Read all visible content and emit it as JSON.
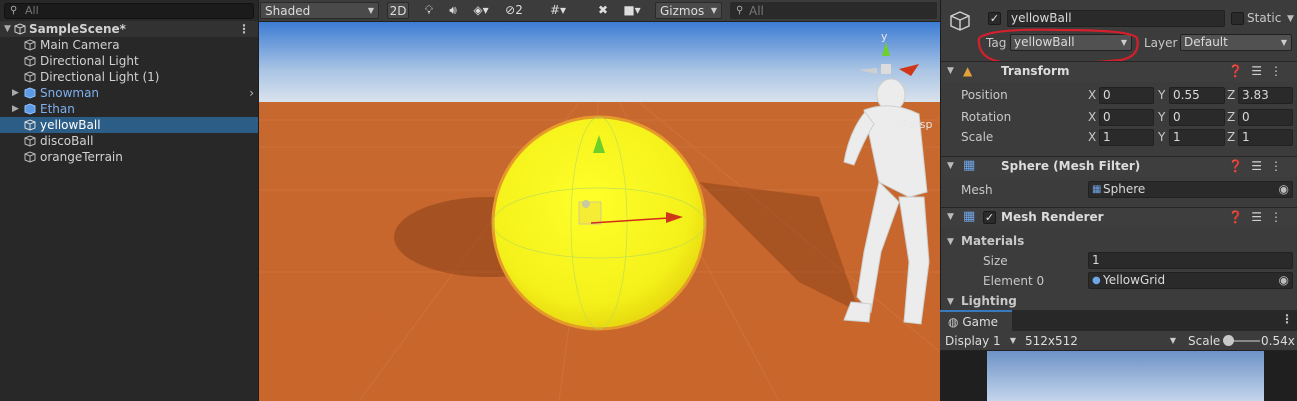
{
  "hierarchy": {
    "search_placeholder": "All",
    "scene_name": "SampleScene*",
    "items": [
      {
        "label": "Main Camera"
      },
      {
        "label": "Directional Light"
      },
      {
        "label": "Directional Light (1)"
      },
      {
        "label": "Snowman"
      },
      {
        "label": "Ethan"
      },
      {
        "label": "yellowBall"
      },
      {
        "label": "discoBall"
      },
      {
        "label": "orangeTerrain"
      }
    ],
    "selected": "yellowBall",
    "prefab_color": "#7fb0ef",
    "selection_color": "#2c5d87"
  },
  "scene_toolbar": {
    "shading_mode": "Shaded",
    "mode_2d": "2D",
    "hidden_count": "2",
    "gizmos_label": "Gizmos",
    "search_placeholder": "All",
    "gizmo_axis_y": "y",
    "persp_label": "<Persp"
  },
  "inspector": {
    "object_name": "yellowBall",
    "static_label": "Static",
    "tag_label": "Tag",
    "tag_value": "yellowBall",
    "layer_label": "Layer",
    "layer_value": "Default",
    "transform": {
      "title": "Transform",
      "position_label": "Position",
      "rotation_label": "Rotation",
      "scale_label": "Scale",
      "position": {
        "x": "0",
        "y": "0.55",
        "z": "3.83"
      },
      "rotation": {
        "x": "0",
        "y": "0",
        "z": "0"
      },
      "scale": {
        "x": "1",
        "y": "1",
        "z": "1"
      }
    },
    "axis_labels": {
      "x": "X",
      "y": "Y",
      "z": "Z"
    },
    "mesh_filter": {
      "title": "Sphere (Mesh Filter)",
      "mesh_label": "Mesh",
      "mesh_value": "Sphere"
    },
    "mesh_renderer": {
      "title": "Mesh Renderer",
      "materials_label": "Materials",
      "size_label": "Size",
      "size_value": "1",
      "element0_label": "Element 0",
      "element0_value": "YellowGrid",
      "lighting_label": "Lighting"
    },
    "annotation_color": "#d61f2c"
  },
  "game": {
    "tab_label": "Game",
    "display_value": "Display 1",
    "resolution_value": "512x512",
    "scale_label": "Scale",
    "scale_value": "0.54x",
    "scale_slider_level": 0.1
  }
}
